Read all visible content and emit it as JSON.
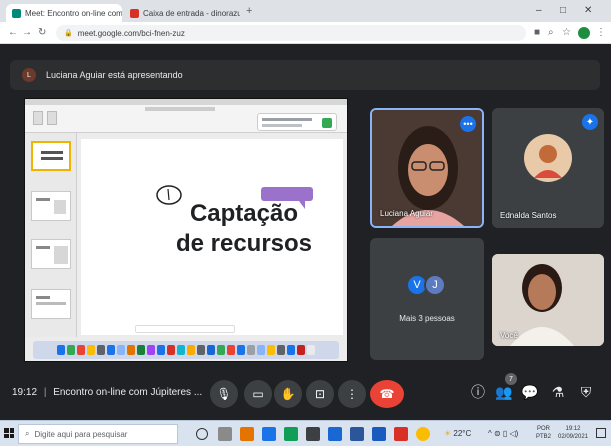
{
  "browser": {
    "tabs": [
      {
        "label": "Meet: Encontro on-line com",
        "favicon_color": "#00897b",
        "active": true
      },
      {
        "label": "Caixa de entrada - dinorazuzan",
        "favicon_color": "#d93025",
        "active": false
      }
    ],
    "new_tab": "+",
    "url": "meet.google.com/bci-fnen-zuz",
    "window_controls": {
      "minimize": "–",
      "maximize": "□",
      "close": "✕"
    }
  },
  "meet": {
    "presenter_initial": "L",
    "presenter_banner": "Luciana Aguiar está apresentando",
    "slide": {
      "title": "Captação\nde recursos"
    },
    "participants": [
      {
        "name": "Luciana Aguiar",
        "type": "video",
        "speaking": true
      },
      {
        "name": "Ednalda Santos",
        "type": "avatar"
      },
      {
        "name": "Mais 3 pessoas",
        "type": "group",
        "initials": [
          "V",
          "J"
        ]
      },
      {
        "name": "Você",
        "type": "video"
      }
    ],
    "meeting_time": "19:12",
    "meeting_title": "Encontro on-line com Júpiteres ...",
    "participant_count_badge": "7",
    "colors": {
      "end_call": "#ea4335",
      "accent": "#8ab4f8",
      "avatar_blue": "#1a73e8"
    }
  },
  "taskbar": {
    "search_placeholder": "Digite aqui para pesquisar",
    "temperature": "22°C",
    "language": "POR",
    "language_sub": "PTB2",
    "time": "19:12",
    "date": "02/09/2021"
  }
}
